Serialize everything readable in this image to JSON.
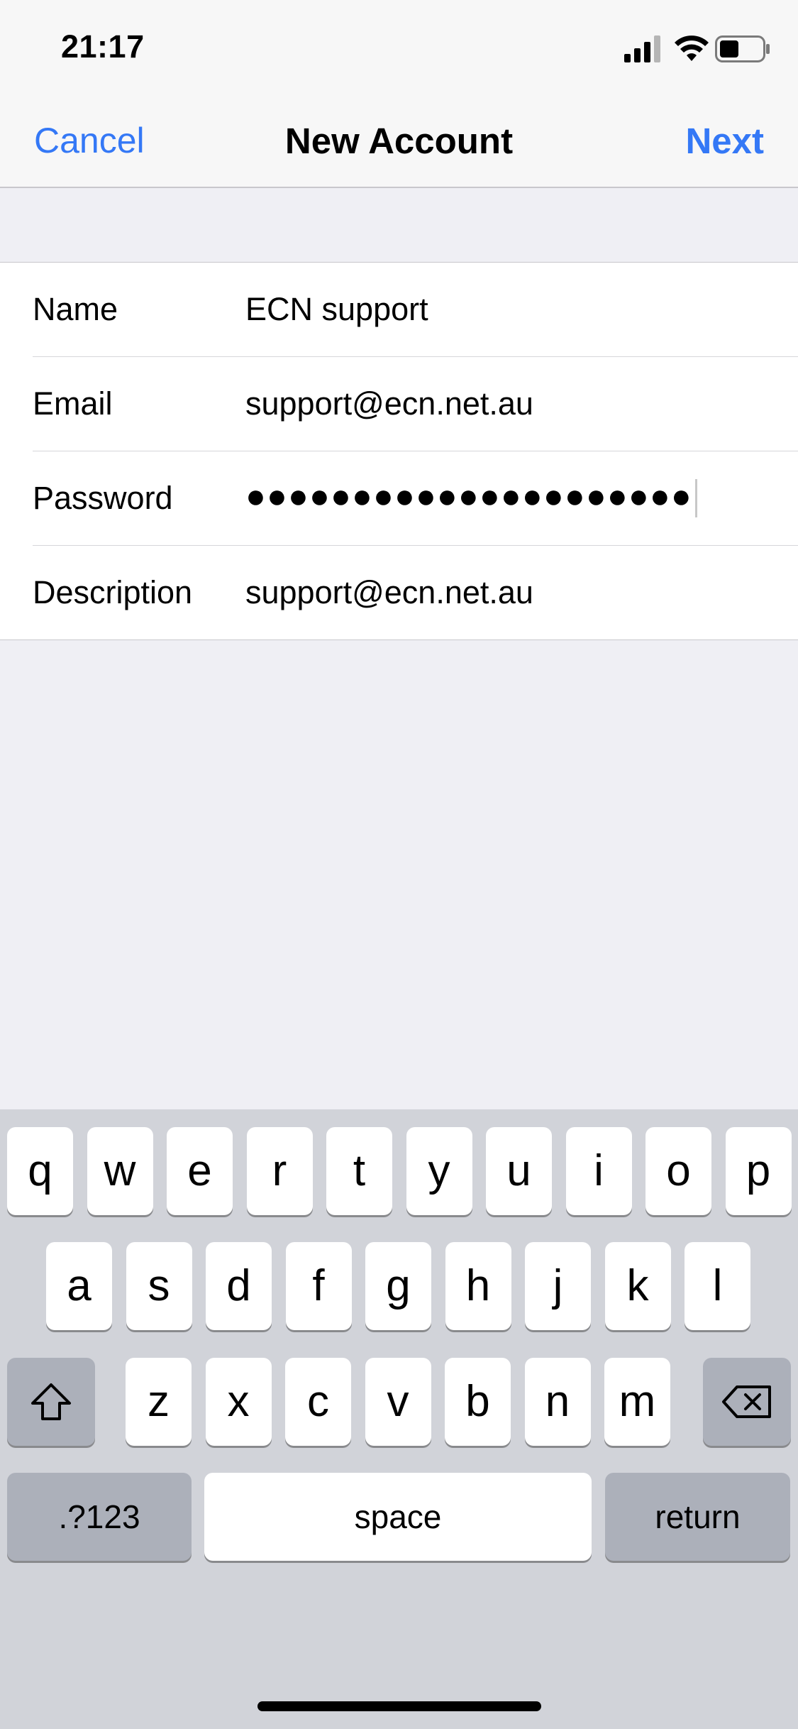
{
  "status_bar": {
    "time": "21:17",
    "icons": [
      "signal-icon",
      "wifi-icon",
      "battery-icon"
    ]
  },
  "nav": {
    "cancel": "Cancel",
    "title": "New Account",
    "next": "Next",
    "accent": "#3478f6"
  },
  "form": {
    "rows": [
      {
        "label": "Name",
        "value": "ECN support"
      },
      {
        "label": "Email",
        "value": "support@ecn.net.au"
      },
      {
        "label": "Password",
        "value": "●●●●●●●●●●●●●●●●●●●●●"
      },
      {
        "label": "Description",
        "value": "support@ecn.net.au"
      }
    ]
  },
  "keyboard": {
    "row1": [
      "q",
      "w",
      "e",
      "r",
      "t",
      "y",
      "u",
      "i",
      "o",
      "p"
    ],
    "row2": [
      "a",
      "s",
      "d",
      "f",
      "g",
      "h",
      "j",
      "k",
      "l"
    ],
    "row3": [
      "z",
      "x",
      "c",
      "v",
      "b",
      "n",
      "m"
    ],
    "numbers": ".?123",
    "space": "space",
    "return": "return"
  }
}
